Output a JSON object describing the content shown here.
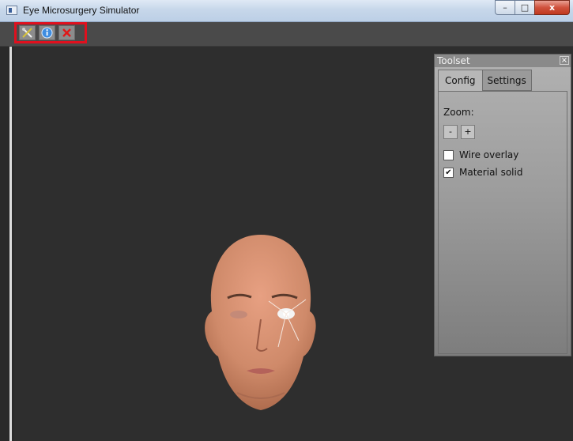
{
  "window": {
    "title": "Eye Microsurgery Simulator",
    "controls": {
      "minimize": "–",
      "maximize": "□",
      "close": "x"
    }
  },
  "toolbar": {
    "tools": [
      {
        "name": "tools",
        "icon": "tools-icon"
      },
      {
        "name": "info",
        "icon": "info-icon"
      },
      {
        "name": "close",
        "icon": "close-x-icon"
      }
    ]
  },
  "toolset": {
    "title": "Toolset",
    "close_glyph": "×",
    "tabs": [
      {
        "label": "Config",
        "active": true
      },
      {
        "label": "Settings",
        "active": false
      }
    ],
    "zoom": {
      "label": "Zoom:",
      "minus": "-",
      "plus": "+"
    },
    "options": [
      {
        "label": "Wire overlay",
        "checked": false
      },
      {
        "label": "Material solid",
        "checked": true
      }
    ]
  }
}
